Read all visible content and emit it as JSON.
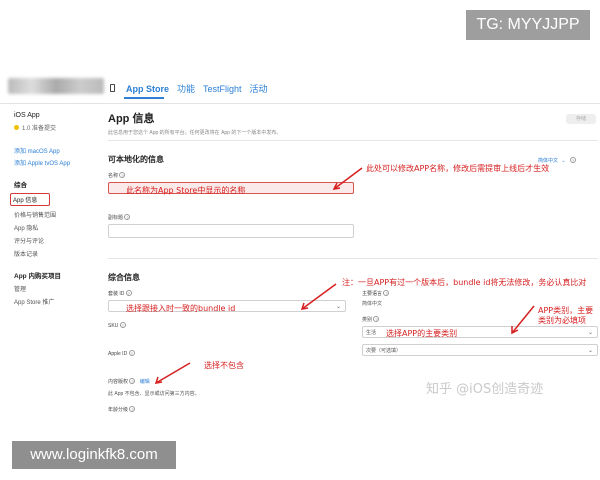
{
  "overlay": {
    "tg_badge": "TG: MYYJJPP",
    "url_badge": "www.loginkfk8.com",
    "watermark": "知乎 @iOS创造奇迹"
  },
  "nav": {
    "tabs": [
      {
        "label": "App Store",
        "active": true
      },
      {
        "label": "功能",
        "active": false
      },
      {
        "label": "TestFlight",
        "active": false
      },
      {
        "label": "活动",
        "active": false
      }
    ]
  },
  "sidebar": {
    "app_label": "iOS App",
    "status": "1.0 准备提交",
    "links": [
      "添加 macOS App",
      "添加 Apple tvOS App"
    ],
    "general_head": "综合",
    "general_items": [
      "App 信息",
      "价格与销售范围",
      "App 隐私",
      "评分与评论",
      "版本记录"
    ],
    "iap_head": "App 内购买项目",
    "iap_items": [
      "管理",
      "App Store 推广"
    ]
  },
  "main": {
    "title": "App 信息",
    "subtitle": "此信息用于您这个 App 的所有平台。任何更改将在 App 的下一个版本中发布。",
    "save_label": "存储",
    "localizable_title": "可本地化的信息",
    "lang_select": "简体中文",
    "name_label": "名称",
    "name_value": "此名称为App Store中显示的名称",
    "subtitle_label": "副标题",
    "general_title": "综合信息",
    "bundle_label": "套装 ID",
    "bundle_value": "选择跟接入时一致的bundle id",
    "sku_label": "SKU",
    "appleid_label": "Apple ID",
    "primary_lang_label": "主要语言",
    "primary_lang_value": "简体中文",
    "category_label": "类别",
    "category_primary": "生活",
    "category_primary_note": "选择APP的主要类别",
    "category_secondary": "次要（可选填）",
    "content_rights_label": "内容版权",
    "content_rights_edit": "编辑",
    "content_rights_value": "此 App 不包含、显示或访问第三方内容。",
    "age_label": "年龄分级"
  },
  "annotations": {
    "name_note": "此处可以修改APP名称，修改后需提审上线后才生效",
    "bundle_note": "注：一旦APP有过一个版本后，bundle id将无法修改，务必认真比对",
    "content_note": "选择不包含",
    "category_note": "APP类别，主要类别为必填项"
  },
  "colors": {
    "accent": "#2b7fd5",
    "annotation": "#d62020"
  }
}
